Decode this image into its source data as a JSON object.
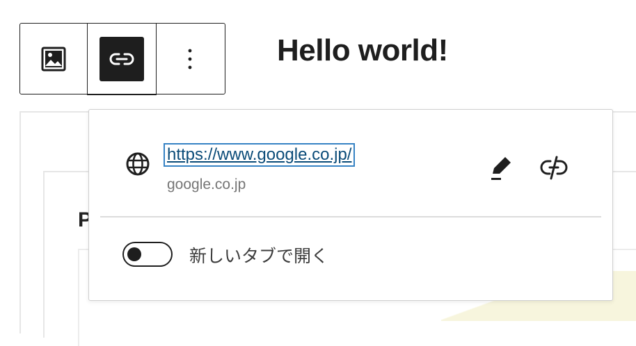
{
  "editor": {
    "heading": "Hello world!",
    "partial_text": "P"
  },
  "toolbar": {
    "buttons": [
      {
        "icon": "image-icon"
      },
      {
        "icon": "link-icon",
        "active": true
      },
      {
        "icon": "more-options-icon"
      }
    ]
  },
  "link_popover": {
    "url": "https://www.google.co.jp/",
    "domain": "google.co.jp",
    "toggle_label": "新しいタブで開く",
    "toggle_checked": false
  },
  "colors": {
    "link": "#0a4b78",
    "focus": "#3582c4",
    "text": "#1e1e1e",
    "muted": "#757575"
  }
}
